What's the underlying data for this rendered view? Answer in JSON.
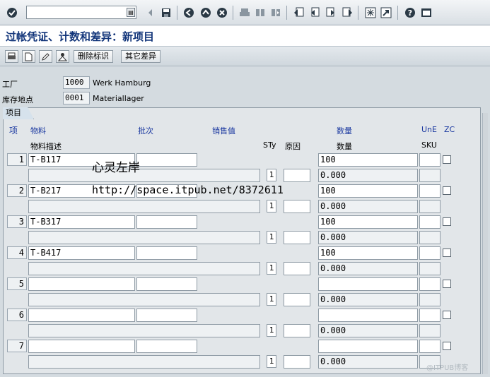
{
  "command_field": {
    "value": "",
    "placeholder": ""
  },
  "title": "过帐凭证、计数和差异：新项目",
  "app_toolbar": {
    "delete_label": "删除标识",
    "other_diff_label": "其它差异"
  },
  "header": {
    "plant_label": "工厂",
    "plant_value": "1000",
    "plant_text": "Werk Hamburg",
    "sloc_label": "库存地点",
    "sloc_value": "0001",
    "sloc_text": "Materiallager"
  },
  "table": {
    "tab_label": "项目",
    "headers": {
      "item": "项",
      "material": "物料",
      "batch": "批次",
      "sales_value": "销售值",
      "quantity": "数量",
      "une": "UnE",
      "zc": "ZC"
    },
    "subheaders": {
      "material_desc": "物料描述",
      "sty": "STy",
      "reason": "原因",
      "quantity": "数量",
      "sku": "SKU"
    },
    "rows": [
      {
        "num": "1",
        "material": "T-B117",
        "qty": "100",
        "sty": "1",
        "qty_sku": "0.000"
      },
      {
        "num": "2",
        "material": "T-B217",
        "qty": "100",
        "sty": "1",
        "qty_sku": "0.000"
      },
      {
        "num": "3",
        "material": "T-B317",
        "qty": "100",
        "sty": "1",
        "qty_sku": "0.000"
      },
      {
        "num": "4",
        "material": "T-B417",
        "qty": "100",
        "sty": "1",
        "qty_sku": "0.000"
      },
      {
        "num": "5",
        "material": "",
        "qty": "",
        "sty": "1",
        "qty_sku": "0.000"
      },
      {
        "num": "6",
        "material": "",
        "qty": "",
        "sty": "1",
        "qty_sku": "0.000"
      },
      {
        "num": "7",
        "material": "",
        "qty": "",
        "sty": "1",
        "qty_sku": "0.000"
      }
    ]
  },
  "overlay": {
    "line1": "心灵左岸",
    "line2": "http://space.itpub.net/8372611"
  },
  "watermark": "@ITPUB博客"
}
